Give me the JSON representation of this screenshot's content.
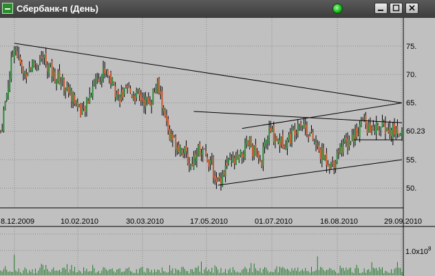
{
  "window": {
    "title": "Сбербанк-п (День)",
    "colors": {
      "bull": "#2e8b3a",
      "bear": "#c9572e",
      "wick": "#000000",
      "volume": "#1f7a2a",
      "chart_bg": "#c0c0c0",
      "grid": "#8c8c8c"
    }
  },
  "price_axis": {
    "labels": [
      "75.",
      "70.",
      "65.",
      "60.23",
      "55.",
      "50."
    ]
  },
  "volume_axis": {
    "label_base": "1.0x10",
    "label_exp": "8"
  },
  "date_axis": {
    "labels": [
      "8.12.2009",
      "10.02.2010",
      "30.03.2010",
      "17.05.2010",
      "01.07.2010",
      "16.08.2010",
      "29.09.2010"
    ]
  },
  "chart_data": {
    "type": "candlestick",
    "ylim": [
      47,
      78
    ],
    "last_price": 60.23,
    "x_ticks": [
      "8.12.2009",
      "10.02.2010",
      "30.03.2010",
      "17.05.2010",
      "01.07.2010",
      "16.08.2010",
      "29.09.2010"
    ],
    "close_path": [
      [
        0,
        60
      ],
      [
        6,
        70
      ],
      [
        9,
        75.5
      ],
      [
        15,
        70
      ],
      [
        22,
        72
      ],
      [
        28,
        73
      ],
      [
        35,
        70
      ],
      [
        40,
        69
      ],
      [
        48,
        66
      ],
      [
        55,
        63
      ],
      [
        62,
        69
      ],
      [
        70,
        71
      ],
      [
        78,
        66
      ],
      [
        85,
        67
      ],
      [
        92,
        66
      ],
      [
        98,
        65
      ],
      [
        104,
        68
      ],
      [
        112,
        59
      ],
      [
        120,
        57
      ],
      [
        126,
        54
      ],
      [
        130,
        57
      ],
      [
        138,
        55
      ],
      [
        144,
        51
      ],
      [
        150,
        54
      ],
      [
        158,
        55
      ],
      [
        165,
        58
      ],
      [
        172,
        54
      ],
      [
        178,
        60
      ],
      [
        186,
        58
      ],
      [
        192,
        59
      ],
      [
        198,
        62
      ],
      [
        204,
        60
      ],
      [
        212,
        56
      ],
      [
        220,
        54
      ],
      [
        224,
        57
      ],
      [
        230,
        58
      ],
      [
        236,
        60
      ],
      [
        240,
        62
      ],
      [
        245,
        60
      ],
      [
        250,
        61
      ],
      [
        258,
        60
      ],
      [
        266,
        60
      ]
    ],
    "trendlines": [
      {
        "from": [
          9,
          75.5
        ],
        "to": [
          266,
          65
        ]
      },
      {
        "from": [
          128,
          63.5
        ],
        "to": [
          266,
          61.5
        ]
      },
      {
        "from": [
          160,
          60.5
        ],
        "to": [
          266,
          65
        ]
      },
      {
        "from": [
          144,
          50.5
        ],
        "to": [
          266,
          55
        ]
      },
      {
        "from": [
          234,
          58.5
        ],
        "to": [
          266,
          58.5
        ]
      }
    ],
    "volume_peaks": [
      {
        "bar": 9,
        "value": 1.35
      },
      {
        "bar": 210,
        "value": 1.25
      }
    ]
  }
}
